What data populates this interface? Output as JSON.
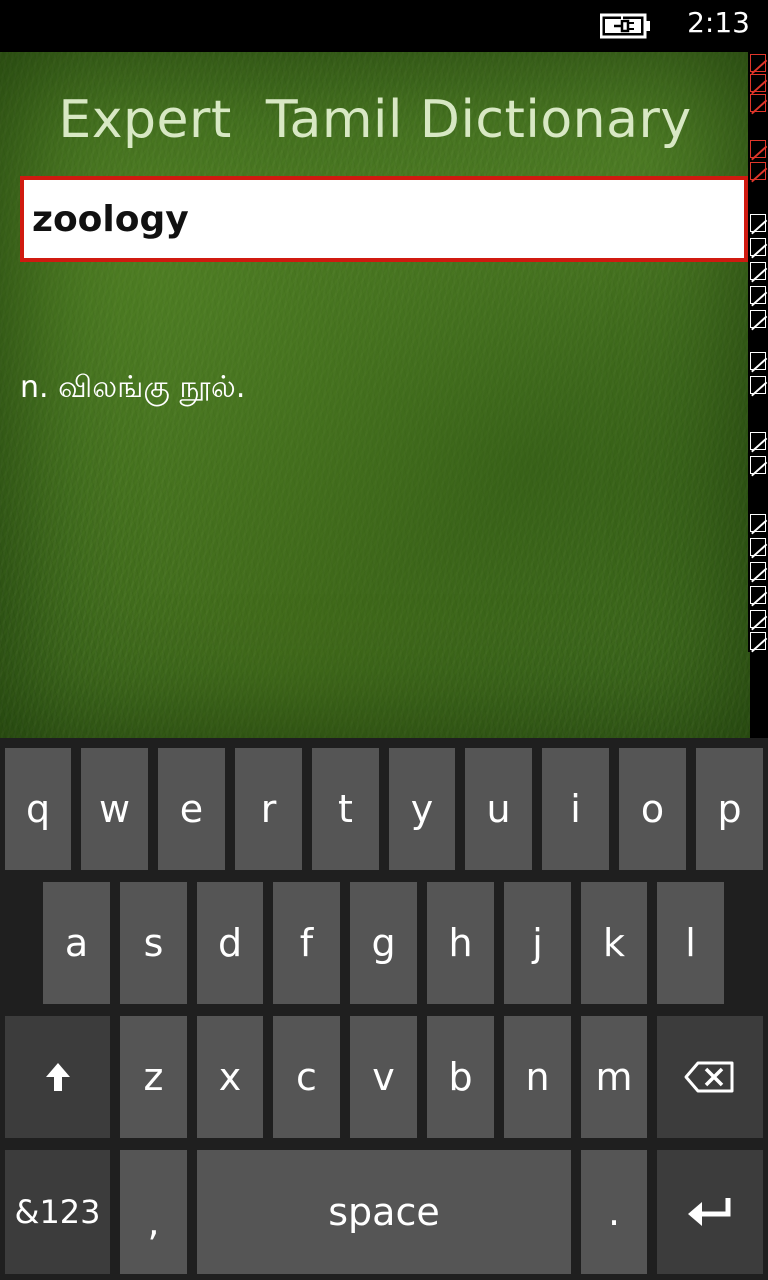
{
  "status_bar": {
    "time": "2:13",
    "battery_icon": "battery-charging-icon"
  },
  "app": {
    "title": "Expert  Tamil Dictionary",
    "search": {
      "value": "zoology",
      "placeholder": ""
    },
    "definition": "n. விலங்கு நூல்."
  },
  "keyboard": {
    "row1": [
      "q",
      "w",
      "e",
      "r",
      "t",
      "y",
      "u",
      "i",
      "o",
      "p"
    ],
    "row2": [
      "a",
      "s",
      "d",
      "f",
      "g",
      "h",
      "j",
      "k",
      "l"
    ],
    "row3": [
      "z",
      "x",
      "c",
      "v",
      "b",
      "n",
      "m"
    ],
    "shift_icon": "shift-arrow-icon",
    "backspace_icon": "backspace-icon",
    "numbers_label": "&123",
    "comma_label": ",",
    "space_label": "space",
    "period_label": ".",
    "enter_icon": "enter-icon"
  },
  "colors": {
    "accent_border": "#d01a10",
    "key_background": "#555555",
    "keyboard_background": "#1f1f1f",
    "title_color": "#d8e8c4"
  }
}
